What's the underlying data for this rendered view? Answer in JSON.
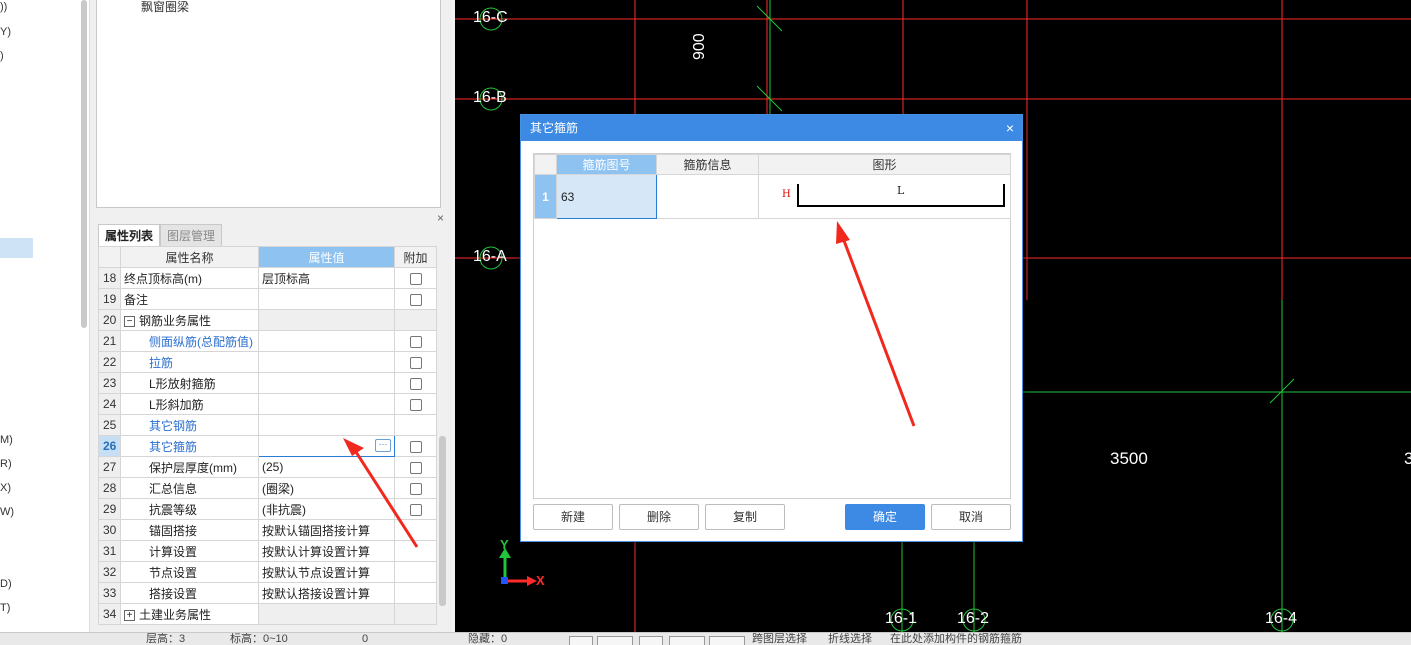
{
  "left_strip": {
    "labels": [
      "))",
      "Y)",
      ")",
      "M)",
      "R)",
      "X)",
      "W)",
      "D)",
      "T)"
    ]
  },
  "tree": {
    "item": "飘窗圈梁"
  },
  "tabs": [
    {
      "label": "属性列表",
      "active": true
    },
    {
      "label": "图层管理",
      "active": false
    }
  ],
  "props": {
    "headers": {
      "name": "属性名称",
      "value": "属性值",
      "extra": "附加"
    },
    "rows": [
      {
        "num": "18",
        "name": "终点顶标高(m)",
        "value": "层顶标高"
      },
      {
        "num": "19",
        "name": "备注",
        "value": ""
      },
      {
        "num": "20",
        "name": "钢筋业务属性",
        "value": ""
      },
      {
        "num": "21",
        "name": "侧面纵筋(总配筋值)",
        "value": ""
      },
      {
        "num": "22",
        "name": "拉筋",
        "value": ""
      },
      {
        "num": "23",
        "name": "L形放射箍筋",
        "value": ""
      },
      {
        "num": "24",
        "name": "L形斜加筋",
        "value": ""
      },
      {
        "num": "25",
        "name": "其它钢筋",
        "value": ""
      },
      {
        "num": "26",
        "name": "其它箍筋",
        "value": ""
      },
      {
        "num": "27",
        "name": "保护层厚度(mm)",
        "value": "(25)"
      },
      {
        "num": "28",
        "name": "汇总信息",
        "value": "(圈梁)"
      },
      {
        "num": "29",
        "name": "抗震等级",
        "value": "(非抗震)"
      },
      {
        "num": "30",
        "name": "锚固搭接",
        "value": "按默认锚固搭接计算"
      },
      {
        "num": "31",
        "name": "计算设置",
        "value": "按默认计算设置计算"
      },
      {
        "num": "32",
        "name": "节点设置",
        "value": "按默认节点设置计算"
      },
      {
        "num": "33",
        "name": "搭接设置",
        "value": "按默认搭接设置计算"
      },
      {
        "num": "34",
        "name": "土建业务属性",
        "value": ""
      }
    ]
  },
  "cad": {
    "axis_labels": {
      "c": "16-C",
      "b": "16-B",
      "a": "16-A",
      "x1": "16-1",
      "x2": "16-2",
      "x4": "16-4"
    },
    "dims": {
      "d900": "900",
      "d3500": "3500",
      "d3": "3"
    },
    "ucs": {
      "x": "X",
      "y": "Y"
    },
    "colors": {
      "grid_red": "#ff2a2a",
      "grid_green": "#22c43a",
      "background": "#000000"
    }
  },
  "status": {
    "f1": "层高：3",
    "f2": "标高：0~10",
    "f3": "0",
    "f4": "隐藏：0",
    "b1": "跨图层选择",
    "b2": "折线选择",
    "hint": "在此处添加构件的钢筋箍筋"
  },
  "dialog": {
    "title": "其它箍筋",
    "headers": {
      "num": "箍筋图号",
      "info": "箍筋信息",
      "shape": "图形"
    },
    "row": {
      "index": "1",
      "num": "63",
      "info": "",
      "shape_h": "H",
      "shape_l": "L"
    },
    "buttons": {
      "new": "新建",
      "delete": "删除",
      "copy": "复制",
      "ok": "确定",
      "cancel": "取消"
    }
  },
  "accent": {
    "primary_blue": "#3c8ae3",
    "highlight_blue": "#8ec2f0",
    "arrow_red": "#f0281e"
  }
}
